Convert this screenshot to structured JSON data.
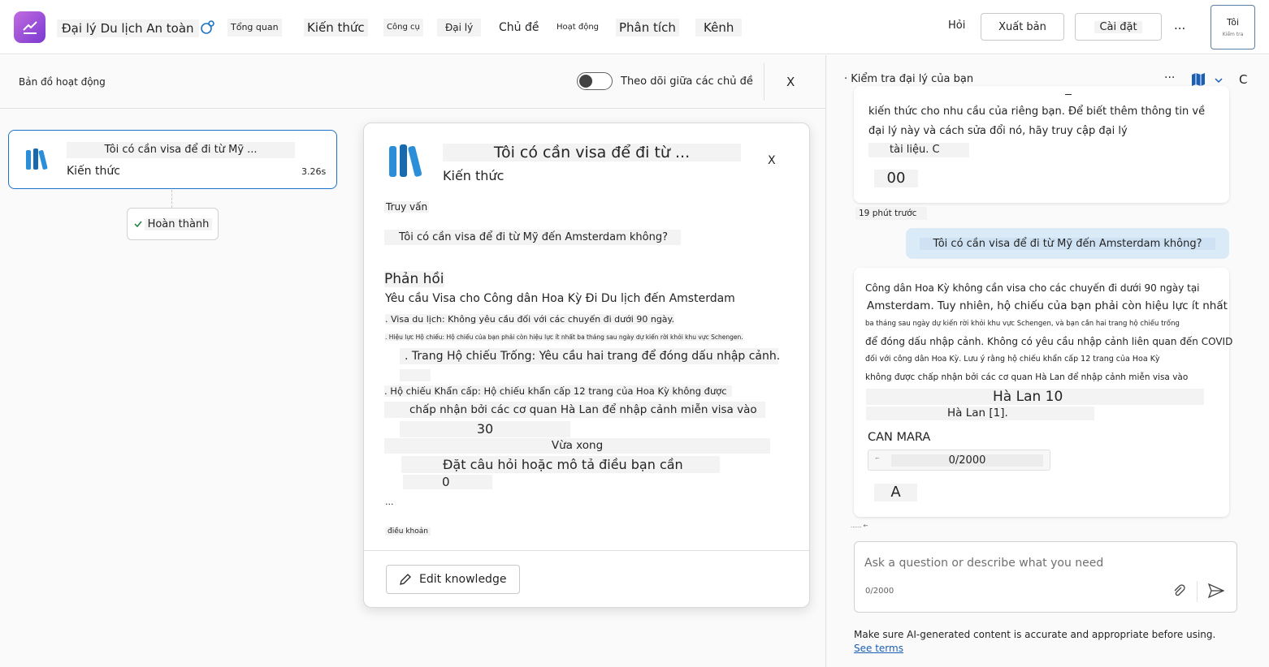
{
  "header": {
    "app_name": "Đại lý Du lịch An toàn",
    "nav": [
      "Tổng quan",
      "Kiến thức",
      "Công cụ",
      "Đại lý",
      "Chủ đề",
      "Hoạt động",
      "Phân tích",
      "Kênh"
    ],
    "ask_label": "Hỏi",
    "publish_label": "Xuất bản",
    "settings_label": "Cài đặt",
    "more_label": "...",
    "me_label": "Tôi",
    "me_sub": "Kiểm tra"
  },
  "activity_map": {
    "title": "Bản đồ hoạt động",
    "toggle_label": "Theo dõi giữa các chủ đề",
    "close_label": "X",
    "node": {
      "title": "Tôi có cần visa để đi từ Mỹ ...",
      "type": "Kiến thức",
      "duration": "3.26s"
    },
    "done_label": "Hoàn thành"
  },
  "detail": {
    "title": "Tôi có cần visa để đi từ ...",
    "subtitle": "Kiến thức",
    "close_label": "X",
    "query_label": "Truy vấn",
    "query_text": "Tôi có cần visa để đi từ Mỹ đến Amsterdam không?",
    "response_label": "Phản hồi",
    "lines": [
      "Yêu cầu Visa cho Công dân Hoa Kỳ Đi Du lịch đến Amsterdam",
      ". Visa du lịch: Không yêu cầu đối với các chuyến đi dưới 90 ngày.",
      ". Hiệu lực Hộ chiếu: Hộ chiếu của bạn phải còn hiệu lực ít nhất ba tháng sau ngày dự kiến rời khỏi khu vực Schengen.",
      ". Trang Hộ chiếu Trống: Yêu cầu hai trang để đóng dấu nhập cảnh.",
      ". Hộ chiếu Khẩn cấp: Hộ chiếu khẩn cấp 12 trang của Hoa Kỳ không được",
      "chấp nhận bởi các cơ quan Hà Lan để nhập cảnh miễn visa vào",
      "30",
      "Vừa xong",
      "Đặt câu hỏi hoặc mô tả điều bạn cần",
      "0",
      "...",
      "điều khoản"
    ],
    "edit_button": "Edit knowledge"
  },
  "test_pane": {
    "title": "· Kiểm tra đại lý của bạn",
    "more_label": "···",
    "refresh_label": "C",
    "bot_msg1_lines": [
      "kiến thức cho nhu cầu của riêng bạn. Để biết thêm thông tin về",
      "đại lý này và cách sửa đổi nó, hãy truy cập đại lý",
      "tài liệu. C",
      "00"
    ],
    "timestamp": "19 phút trước",
    "user_msg": "Tôi có cần visa để đi từ Mỹ đến Amsterdam không?",
    "bot_msg2_lines": [
      "Công dân Hoa Kỳ không cần visa cho các chuyến đi dưới 90 ngày tại",
      "Amsterdam. Tuy nhiên, hộ chiếu của bạn phải còn hiệu lực ít nhất",
      "ba tháng sau ngày dự kiến rời khỏi khu vực Schengen, và bạn cần hai trang hộ chiếu trống",
      "để đóng dấu nhập cảnh. Không có yêu cầu nhập cảnh liên quan đến COVID",
      "đối với công dân Hoa Kỳ. Lưu ý rằng hộ chiếu khẩn cấp 12 trang của Hoa Kỳ",
      "không được chấp nhận bởi các cơ quan Hà Lan để nhập cảnh miễn visa vào",
      "Hà Lan 10",
      "Hà Lan [1].",
      "CAN MARA",
      "0/2000",
      "A"
    ],
    "small_marker": "...... ←",
    "composer_placeholder": "Ask a question or describe what you need",
    "composer_count": "0/2000",
    "disclaimer": "Make sure AI-generated content is accurate and appropriate before using.",
    "see_terms": "See terms"
  }
}
